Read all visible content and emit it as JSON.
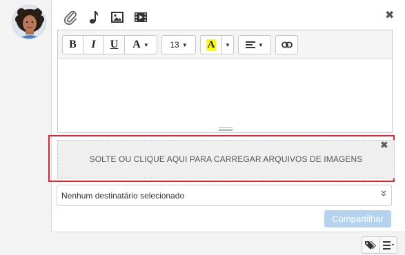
{
  "toolbar": {
    "bold_label": "B",
    "italic_label": "I",
    "underline_label": "U",
    "font_label": "A",
    "font_size": "13",
    "highlight_label": "A",
    "highlight_color": "#ffff00"
  },
  "upload": {
    "dropzone_text": "SOLTE OU CLIQUE AQUI PARA CARREGAR ARQUIVOS DE IMAGENS",
    "highlight_border_color": "#e0252f"
  },
  "recipient": {
    "value": "Nenhum destinatário selecionado"
  },
  "actions": {
    "share_label": "Compartilhar",
    "share_color": "#b5d3ee"
  },
  "icons": {
    "attach": "paperclip-icon",
    "audio": "music-note-icon",
    "image": "image-icon",
    "video": "video-icon",
    "close": "close-icon",
    "link": "link-icon",
    "align": "align-icon",
    "tags": "tags-icon",
    "list": "list-icon",
    "chevron": "chevron-double-down-icon"
  },
  "glyphs": {
    "close": "✖",
    "caret": "▼"
  }
}
